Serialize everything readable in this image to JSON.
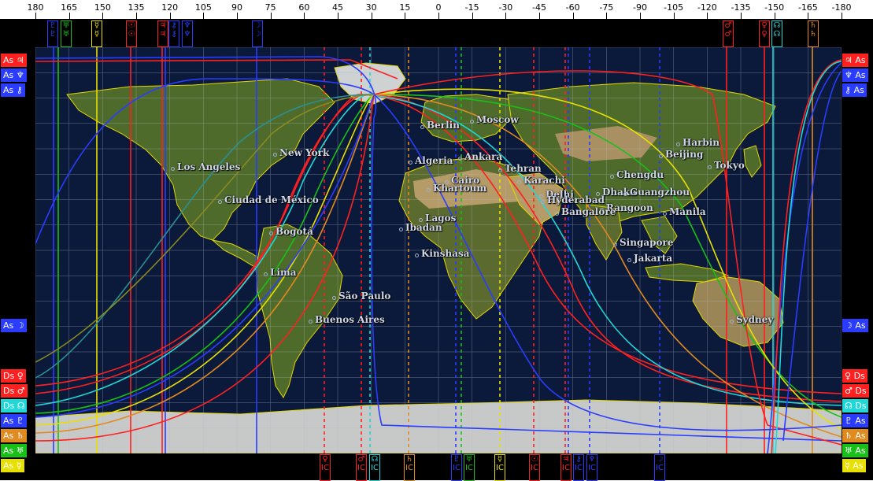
{
  "longitude_ticks": [
    "180",
    "165",
    "150",
    "135",
    "120",
    "105",
    "90",
    "75",
    "60",
    "45",
    "30",
    "15",
    "0",
    "-15",
    "-30",
    "-45",
    "-60",
    "-75",
    "-90",
    "-105",
    "-120",
    "-135",
    "-150",
    "-165",
    "-180"
  ],
  "top_badges": [
    {
      "id": "mc-pluto",
      "top": "♇",
      "bottom": "♇",
      "color": "#2a3cff"
    },
    {
      "id": "mc-uranus",
      "top": "♅",
      "bottom": "♅",
      "color": "#18c018"
    },
    {
      "id": "mc-mars-y",
      "top": "☿",
      "bottom": "☿",
      "color": "#e8e000"
    },
    {
      "id": "mc-sun",
      "top": "☉",
      "bottom": "☉",
      "color": "#ff2020"
    },
    {
      "id": "mc-jupiter",
      "top": "♃",
      "bottom": "♃",
      "color": "#ff2020"
    },
    {
      "id": "mc-chiron",
      "top": "⚷",
      "bottom": "⚷",
      "color": "#2a3cff"
    },
    {
      "id": "mc-neptune",
      "top": "♆",
      "bottom": "♆",
      "color": "#2a3cff"
    },
    {
      "id": "mc-moon",
      "top": "☽",
      "bottom": "☽",
      "color": "#2a3cff"
    },
    {
      "id": "mc-mars",
      "top": "♂",
      "bottom": "♂",
      "color": "#ff2020"
    },
    {
      "id": "mc-venus",
      "top": "♀",
      "bottom": "♀",
      "color": "#ff2020"
    },
    {
      "id": "mc-node",
      "top": "☊",
      "bottom": "☊",
      "color": "#20d8d8"
    },
    {
      "id": "mc-saturn",
      "top": "♄",
      "bottom": "♄",
      "color": "#e08a20"
    }
  ],
  "bottom_badges": [
    {
      "id": "ic-venus",
      "top": "♀",
      "bottom": "IC",
      "color": "#ff2020"
    },
    {
      "id": "ic-mars",
      "top": "♂",
      "bottom": "IC",
      "color": "#ff2020"
    },
    {
      "id": "ic-node",
      "top": "☊",
      "bottom": "IC",
      "color": "#20d8d8"
    },
    {
      "id": "ic-saturn",
      "top": "♄",
      "bottom": "IC",
      "color": "#e08a20"
    },
    {
      "id": "ic-pluto",
      "top": "♇",
      "bottom": "IC",
      "color": "#2a3cff"
    },
    {
      "id": "ic-uranus",
      "top": "♅",
      "bottom": "IC",
      "color": "#18c018"
    },
    {
      "id": "ic-mercury",
      "top": "☿",
      "bottom": "IC",
      "color": "#e8e000"
    },
    {
      "id": "ic-sun",
      "top": "☉",
      "bottom": "IC",
      "color": "#ff2020"
    },
    {
      "id": "ic-jupiter",
      "top": "♃",
      "bottom": "IC",
      "color": "#ff2020"
    },
    {
      "id": "ic-chiron",
      "top": "⚷",
      "bottom": "IC",
      "color": "#2a3cff"
    },
    {
      "id": "ic-neptune",
      "top": "♆",
      "bottom": "IC",
      "color": "#2a3cff"
    },
    {
      "id": "ic-moon",
      "top": "☽",
      "bottom": "IC",
      "color": "#2a3cff"
    }
  ],
  "left_badges": [
    {
      "id": "as-jupiter",
      "label": "As",
      "glyph": "♃",
      "color": "#ff2020"
    },
    {
      "id": "as-neptune",
      "label": "As",
      "glyph": "♆",
      "color": "#2a3cff"
    },
    {
      "id": "as-chiron",
      "label": "As",
      "glyph": "⚷",
      "color": "#2a3cff"
    },
    {
      "id": "as-moon",
      "label": "As",
      "glyph": "☽",
      "color": "#2a3cff"
    },
    {
      "id": "ds-venus",
      "label": "Ds",
      "glyph": "♀",
      "color": "#ff2020"
    },
    {
      "id": "ds-mars",
      "label": "Ds",
      "glyph": "♂",
      "color": "#ff2020"
    },
    {
      "id": "ds-node",
      "label": "Ds",
      "glyph": "☊",
      "color": "#20d8d8"
    },
    {
      "id": "as-pluto",
      "label": "As",
      "glyph": "♇",
      "color": "#2a3cff"
    },
    {
      "id": "as-saturn",
      "label": "As",
      "glyph": "♄",
      "color": "#e08a20"
    },
    {
      "id": "as-uranus",
      "label": "As",
      "glyph": "♅",
      "color": "#18c018"
    },
    {
      "id": "as-mercury",
      "label": "As",
      "glyph": "☿",
      "color": "#e8e000"
    }
  ],
  "right_badges": [
    {
      "id": "r-as-jupiter",
      "label": "As",
      "glyph": "♃",
      "color": "#ff2020"
    },
    {
      "id": "r-as-neptune",
      "label": "As",
      "glyph": "♆",
      "color": "#2a3cff"
    },
    {
      "id": "r-as-chiron",
      "label": "As",
      "glyph": "⚷",
      "color": "#2a3cff"
    },
    {
      "id": "r-as-moon",
      "label": "As",
      "glyph": "☽",
      "color": "#2a3cff"
    },
    {
      "id": "r-ds-venus",
      "label": "Ds",
      "glyph": "♀",
      "color": "#ff2020"
    },
    {
      "id": "r-ds-mars",
      "label": "Ds",
      "glyph": "♂",
      "color": "#ff2020"
    },
    {
      "id": "r-ds-node",
      "label": "Ds",
      "glyph": "☊",
      "color": "#20d8d8"
    },
    {
      "id": "r-as-pluto",
      "label": "As",
      "glyph": "♇",
      "color": "#2a3cff"
    },
    {
      "id": "r-as-saturn",
      "label": "As",
      "glyph": "♄",
      "color": "#e08a20"
    },
    {
      "id": "r-as-uranus",
      "label": "As",
      "glyph": "♅",
      "color": "#18c018"
    },
    {
      "id": "r-as-mercury",
      "label": "As",
      "glyph": "☿",
      "color": "#e8e000"
    }
  ],
  "cities": [
    {
      "name": "Berlin"
    },
    {
      "name": "Moscow"
    },
    {
      "name": "Ankara"
    },
    {
      "name": "Algeria"
    },
    {
      "name": "Cairo"
    },
    {
      "name": "Tehran"
    },
    {
      "name": "Karachi"
    },
    {
      "name": "Delhi"
    },
    {
      "name": "Chengdu"
    },
    {
      "name": "Dhaka"
    },
    {
      "name": "Guangzhou"
    },
    {
      "name": "Rangoon"
    },
    {
      "name": "Bangalore"
    },
    {
      "name": "Harbin"
    },
    {
      "name": "Beijing"
    },
    {
      "name": "Tokyo"
    },
    {
      "name": "Manila"
    },
    {
      "name": "Singapore"
    },
    {
      "name": "Jakarta"
    },
    {
      "name": "Sydney"
    },
    {
      "name": "Los Angeles"
    },
    {
      "name": "New York"
    },
    {
      "name": "Ciudad de México"
    },
    {
      "name": "Bogotá"
    },
    {
      "name": "Lima"
    },
    {
      "name": "São Paulo"
    },
    {
      "name": "Buenos Aires"
    },
    {
      "name": "Lagos"
    },
    {
      "name": "Ibadan"
    },
    {
      "name": "Kinshasa"
    },
    {
      "name": "Khartoum"
    },
    {
      "name": "Hyderabad"
    }
  ],
  "colors": {
    "ocean": "#0b1a3a",
    "land": "#4e6b2c",
    "desert": "#b59b67",
    "ice": "#c7c9c9",
    "coast": "#e5d600",
    "grid": "#b0b8c8",
    "red": "#ff2020",
    "blue": "#2a3cff",
    "green": "#18c018",
    "yellow": "#e8e000",
    "cyan": "#20d8d8",
    "orange": "#e08a20"
  }
}
